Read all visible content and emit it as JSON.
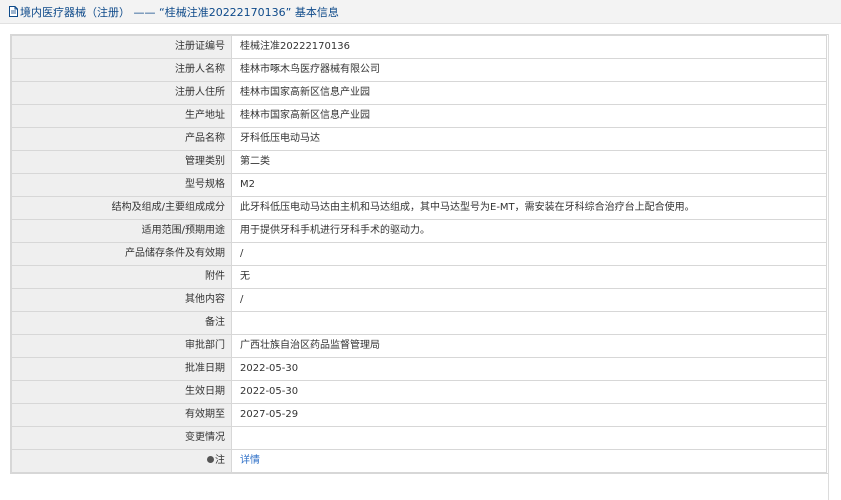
{
  "header": {
    "title": "境内医疗器械（注册） —— “桂械注准20222170136” 基本信息"
  },
  "rows": [
    {
      "label": "注册证编号",
      "value": "桂械注准20222170136"
    },
    {
      "label": "注册人名称",
      "value": "桂林市啄木鸟医疗器械有限公司"
    },
    {
      "label": "注册人住所",
      "value": "桂林市国家高新区信息产业园"
    },
    {
      "label": "生产地址",
      "value": "桂林市国家高新区信息产业园"
    },
    {
      "label": "产品名称",
      "value": "牙科低压电动马达"
    },
    {
      "label": "管理类别",
      "value": "第二类"
    },
    {
      "label": "型号规格",
      "value": "M2"
    },
    {
      "label": "结构及组成/主要组成成分",
      "value": "此牙科低压电动马达由主机和马达组成，其中马达型号为E-MT，需安装在牙科综合治疗台上配合使用。"
    },
    {
      "label": "适用范围/预期用途",
      "value": "用于提供牙科手机进行牙科手术的驱动力。"
    },
    {
      "label": "产品储存条件及有效期",
      "value": "/"
    },
    {
      "label": "附件",
      "value": "无"
    },
    {
      "label": "其他内容",
      "value": "/"
    },
    {
      "label": "备注",
      "value": ""
    },
    {
      "label": "审批部门",
      "value": "广西壮族自治区药品监督管理局"
    },
    {
      "label": "批准日期",
      "value": "2022-05-30"
    },
    {
      "label": "生效日期",
      "value": "2022-05-30"
    },
    {
      "label": "有效期至",
      "value": "2027-05-29"
    },
    {
      "label": "变更情况",
      "value": ""
    }
  ],
  "note_row": {
    "label": "注",
    "link_text": "详情"
  },
  "icons": {
    "title_icon": "document-icon",
    "note_icon": "pin-icon"
  }
}
